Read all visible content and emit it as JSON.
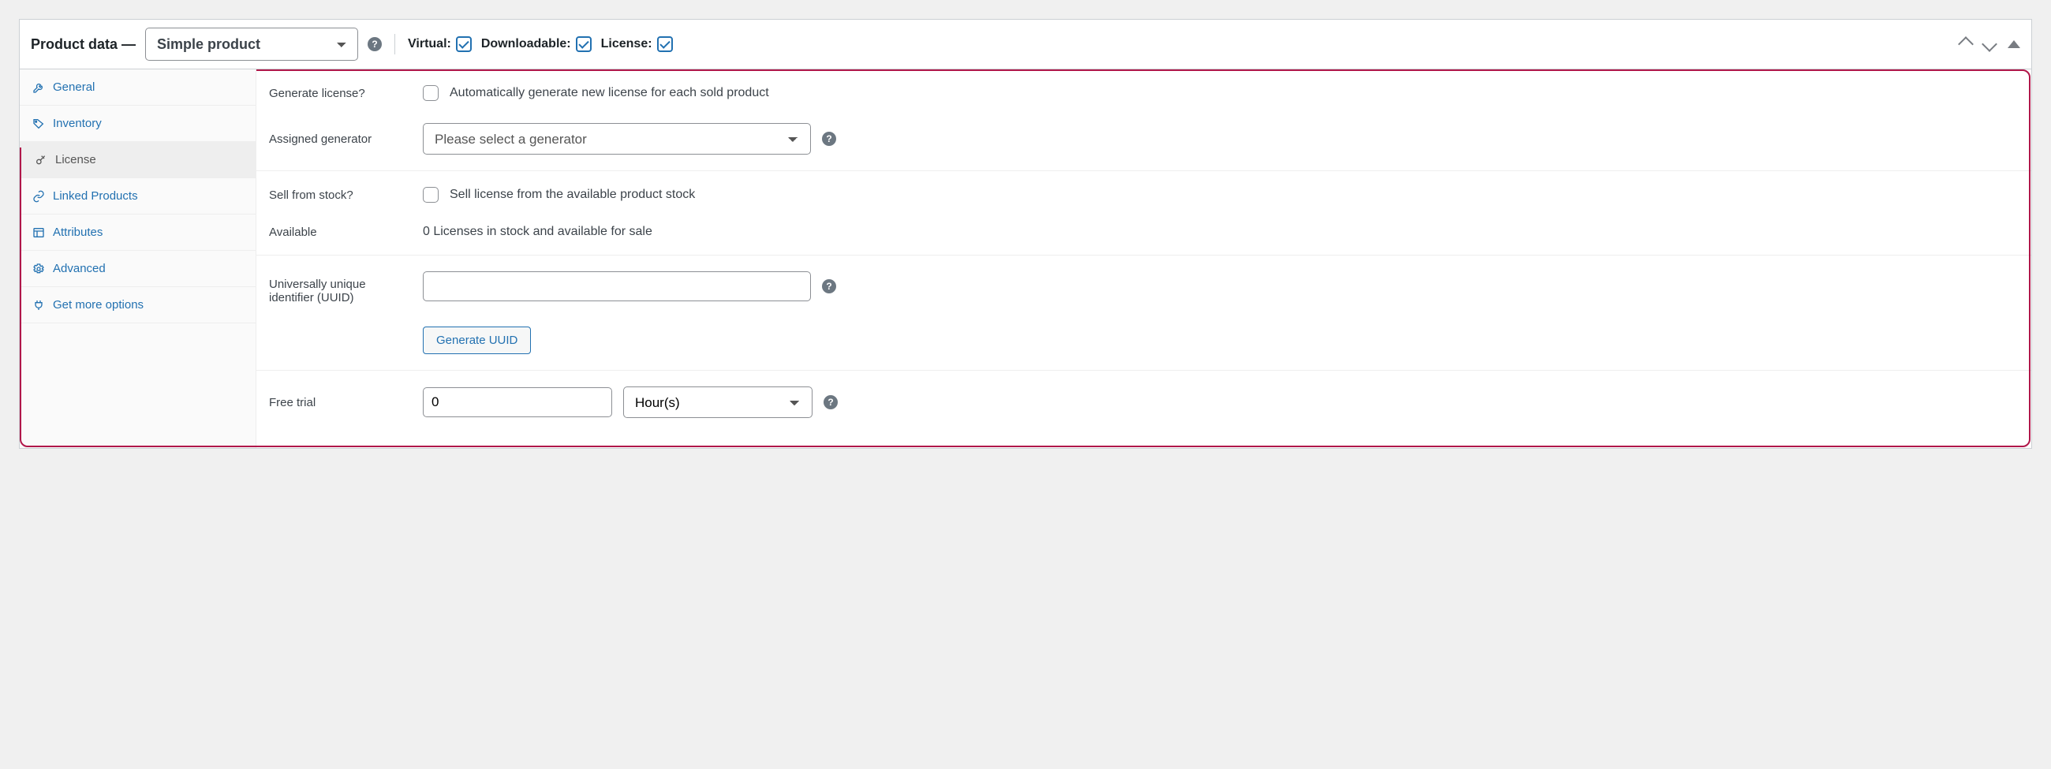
{
  "header": {
    "title": "Product data —",
    "product_type": "Simple product",
    "virtual_label": "Virtual:",
    "downloadable_label": "Downloadable:",
    "license_label": "License:",
    "virtual_checked": true,
    "downloadable_checked": true,
    "license_checked": true
  },
  "sidebar": {
    "tabs": [
      {
        "label": "General",
        "icon": "wrench-icon"
      },
      {
        "label": "Inventory",
        "icon": "tag-icon"
      },
      {
        "label": "License",
        "icon": "key-icon"
      },
      {
        "label": "Linked Products",
        "icon": "link-icon"
      },
      {
        "label": "Attributes",
        "icon": "layout-icon"
      },
      {
        "label": "Advanced",
        "icon": "gear-icon"
      },
      {
        "label": "Get more options",
        "icon": "plug-icon"
      }
    ],
    "active_index": 2
  },
  "form": {
    "generate_license_label": "Generate license?",
    "generate_license_desc": "Automatically generate new license for each sold product",
    "assigned_generator_label": "Assigned generator",
    "assigned_generator_placeholder": "Please select a generator",
    "sell_stock_label": "Sell from stock?",
    "sell_stock_desc": "Sell license from the available product stock",
    "available_label": "Available",
    "available_desc": "0 Licenses in stock and available for sale",
    "uuid_label": "Universally unique identifier (UUID)",
    "uuid_value": "",
    "generate_uuid_btn": "Generate UUID",
    "free_trial_label": "Free trial",
    "free_trial_value": "0",
    "free_trial_unit": "Hour(s)"
  }
}
